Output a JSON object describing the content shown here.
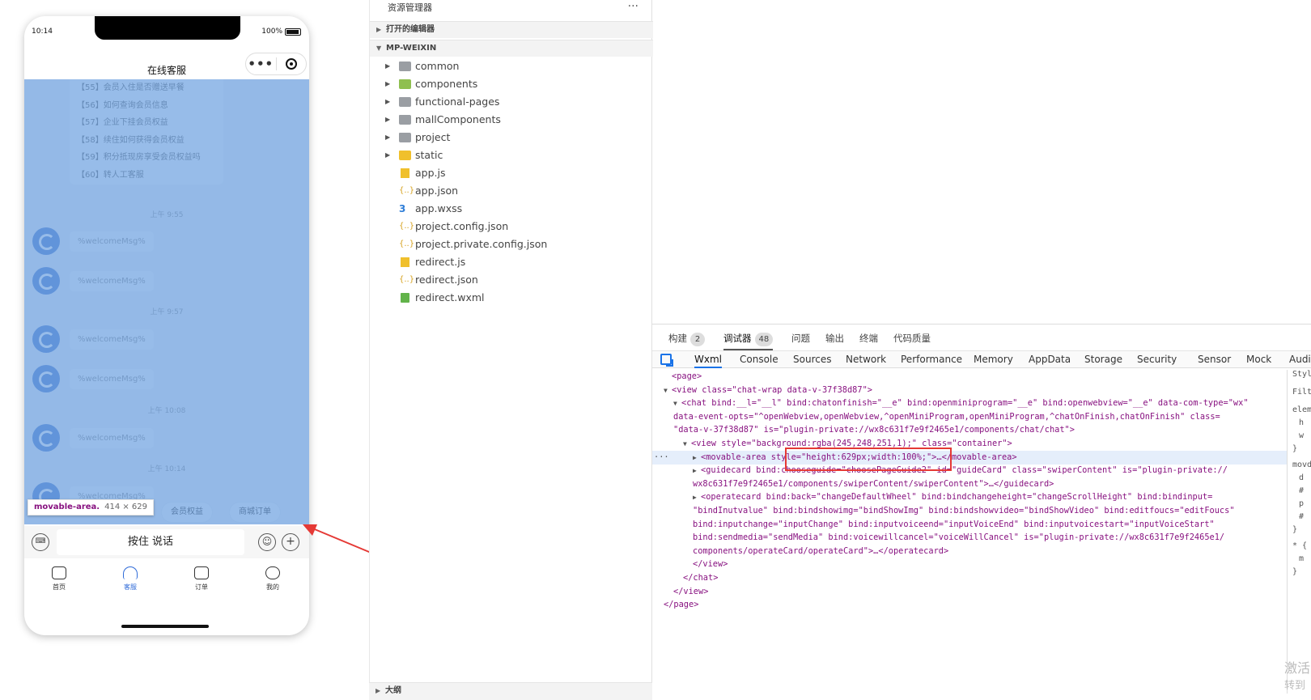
{
  "phone": {
    "time": "10:14",
    "battery": "100%",
    "title": "在线客服",
    "menu_items": [
      "【55】会员入住是否赠送早餐",
      "【56】如何查询会员信息",
      "【57】企业下挂会员权益",
      "【58】续住如何获得会员权益",
      "【59】积分抵现房享受会员权益吗",
      "【60】转人工客服"
    ],
    "timestamps": [
      "上午 9:55",
      "上午 9:57",
      "上午 10:08",
      "上午 10:14"
    ],
    "message_text": "%welcomeMsg%",
    "tooltip_name": "movable-area.",
    "tooltip_size": "414 × 629",
    "quick_replies": [
      "会员权益",
      "商城订单"
    ],
    "hold_to_talk": "按住 说话",
    "plus_glyph": "+",
    "tabs": [
      "首页",
      "客服",
      "订单",
      "我的"
    ]
  },
  "explorer": {
    "title": "资源管理器",
    "more": "···",
    "open_editors": "打开的编辑器",
    "project_root": "MP-WEIXIN",
    "folders": [
      "common",
      "components",
      "functional-pages",
      "mallComponents",
      "project",
      "static"
    ],
    "files": [
      "app.js",
      "app.json",
      "app.wxss",
      "project.config.json",
      "project.private.config.json",
      "redirect.js",
      "redirect.json",
      "redirect.wxml"
    ],
    "json_glyph": "{..}",
    "wxss_glyph": "3",
    "outline": "大纲"
  },
  "devtools": {
    "top_tabs": [
      {
        "label": "构建",
        "badge": "2"
      },
      {
        "label": "调试器",
        "badge": "48"
      },
      {
        "label": "问题",
        "badge": ""
      },
      {
        "label": "输出",
        "badge": ""
      },
      {
        "label": "终端",
        "badge": ""
      },
      {
        "label": "代码质量",
        "badge": ""
      }
    ],
    "panels": [
      "Wxml",
      "Console",
      "Sources",
      "Network",
      "Performance",
      "Memory",
      "AppData",
      "Storage",
      "Security",
      "Sensor",
      "Mock",
      "Audit"
    ],
    "code_lines": [
      {
        "tw": "",
        "text": "<page>"
      },
      {
        "tw": "▼",
        "text": "<view class=\"chat-wrap data-v-37f38d87\">"
      },
      {
        "tw": "▼",
        "text": "<chat bind:__l=\"__l\" bind:chatonfinish=\"__e\" bind:openminiprogram=\"__e\" bind:openwebview=\"__e\" data-com-type=\"wx\""
      },
      {
        "tw": "",
        "text": "data-event-opts=\"^openWebview,openWebview,^openMiniProgram,openMiniProgram,^chatOnFinish,chatOnFinish\" class="
      },
      {
        "tw": "",
        "text": "\"data-v-37f38d87\" is=\"plugin-private://wx8c631f7e9f2465e1/components/chat/chat\">"
      },
      {
        "tw": "▼",
        "text": "<view style=\"background:rgba(245,248,251,1);\" class=\"container\">"
      },
      {
        "tw": "▶",
        "text": "<movable-area style=\"height:629px;width:100%;\">…</movable-area>"
      },
      {
        "tw": "▶",
        "text": "<guidecard bind:chooseguide=\"choosePageGuide2\" id=\"guideCard\" class=\"swiperContent\" is=\"plugin-private://"
      },
      {
        "tw": "",
        "text": "wx8c631f7e9f2465e1/components/swiperContent/swiperContent\">…</guidecard>"
      },
      {
        "tw": "▶",
        "text": "<operatecard bind:back=\"changeDefaultWheel\" bind:bindchangeheight=\"changeScrollHeight\" bind:bindinput="
      },
      {
        "tw": "",
        "text": "\"bindInutvalue\" bind:bindshowimg=\"bindShowImg\" bind:bindshowvideo=\"bindShowVideo\" bind:editfoucs=\"editFoucs\""
      },
      {
        "tw": "",
        "text": "bind:inputchange=\"inputChange\" bind:inputvoiceend=\"inputVoiceEnd\" bind:inputvoicestart=\"inputVoiceStart\""
      },
      {
        "tw": "",
        "text": "bind:sendmedia=\"sendMedia\" bind:voicewillcancel=\"voiceWillCancel\" is=\"plugin-private://wx8c631f7e9f2465e1/"
      },
      {
        "tw": "",
        "text": "components/operateCard/operateCard\">…</operatecard>"
      },
      {
        "tw": "",
        "text": "</view>"
      },
      {
        "tw": "",
        "text": "</chat>"
      },
      {
        "tw": "",
        "text": "</view>"
      },
      {
        "tw": "",
        "text": "</page>"
      }
    ],
    "selected_marker": "···",
    "styles_lines": [
      "Styl",
      "Filte",
      "elem",
      "h",
      "w",
      "}",
      "movd",
      "d",
      "#",
      "p",
      "#",
      "}",
      "* {",
      "m",
      "}"
    ]
  },
  "watermark": [
    "激活",
    "转到"
  ]
}
